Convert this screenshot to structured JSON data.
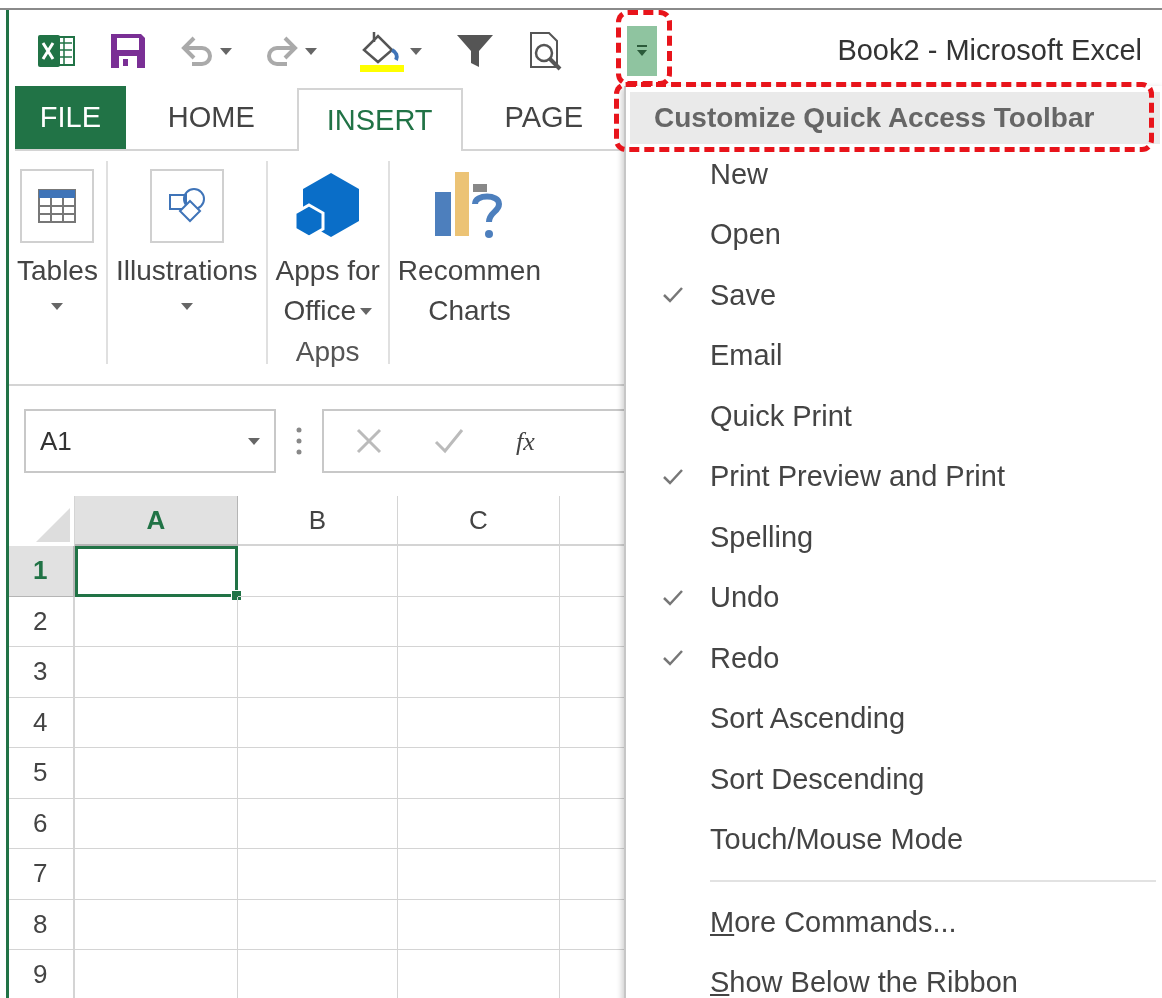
{
  "window": {
    "title": "Book2 - Microsoft Excel"
  },
  "quick_access": {
    "customize_open": true
  },
  "tabs": [
    {
      "label": "FILE",
      "kind": "file",
      "selected": false
    },
    {
      "label": "HOME",
      "kind": "tab",
      "selected": false
    },
    {
      "label": "INSERT",
      "kind": "tab",
      "selected": true
    },
    {
      "label": "PAGE",
      "kind": "tab",
      "selected": false
    }
  ],
  "ribbon": {
    "groups": [
      {
        "buttons": [
          {
            "kind": "tables",
            "lines": [
              "Tables"
            ],
            "dropdown": true
          }
        ]
      },
      {
        "buttons": [
          {
            "kind": "illustrations",
            "lines": [
              "Illustrations"
            ],
            "dropdown": true
          }
        ]
      },
      {
        "title": "Apps",
        "buttons": [
          {
            "kind": "apps",
            "lines": [
              "Apps for",
              "Office"
            ],
            "dropdown": true
          }
        ]
      },
      {
        "buttons": [
          {
            "kind": "charts",
            "lines": [
              "Recommen",
              "Charts"
            ],
            "dropdown": false
          }
        ]
      }
    ]
  },
  "formula_bar": {
    "name_box": "A1",
    "function_label": "fx"
  },
  "grid": {
    "columns": [
      {
        "label": "A",
        "selected": true
      },
      {
        "label": "B",
        "selected": false
      },
      {
        "label": "C",
        "selected": false
      }
    ],
    "rows": [
      {
        "label": "1",
        "selected": true
      },
      {
        "label": "2",
        "selected": false
      },
      {
        "label": "3",
        "selected": false
      },
      {
        "label": "4",
        "selected": false
      },
      {
        "label": "5",
        "selected": false
      },
      {
        "label": "6",
        "selected": false
      },
      {
        "label": "7",
        "selected": false
      },
      {
        "label": "8",
        "selected": false
      },
      {
        "label": "9",
        "selected": false
      }
    ]
  },
  "menu": {
    "title": "Customize Quick Access Toolbar",
    "items": [
      {
        "label": "New",
        "checked": false
      },
      {
        "label": "Open",
        "checked": false
      },
      {
        "label": "Save",
        "checked": true
      },
      {
        "label": "Email",
        "checked": false
      },
      {
        "label": "Quick Print",
        "checked": false
      },
      {
        "label": "Print Preview and Print",
        "checked": true
      },
      {
        "label": "Spelling",
        "checked": false
      },
      {
        "label": "Undo",
        "checked": true
      },
      {
        "label": "Redo",
        "checked": true
      },
      {
        "label": "Sort Ascending",
        "checked": false
      },
      {
        "label": "Sort Descending",
        "checked": false
      },
      {
        "label": "Touch/Mouse Mode",
        "checked": false
      }
    ],
    "commands": [
      {
        "access_key": "M",
        "rest": "ore Commands..."
      },
      {
        "access_key": "S",
        "rest": "how Below the Ribbon"
      }
    ]
  },
  "annotations": {
    "highlight_button": true,
    "highlight_title": true
  }
}
